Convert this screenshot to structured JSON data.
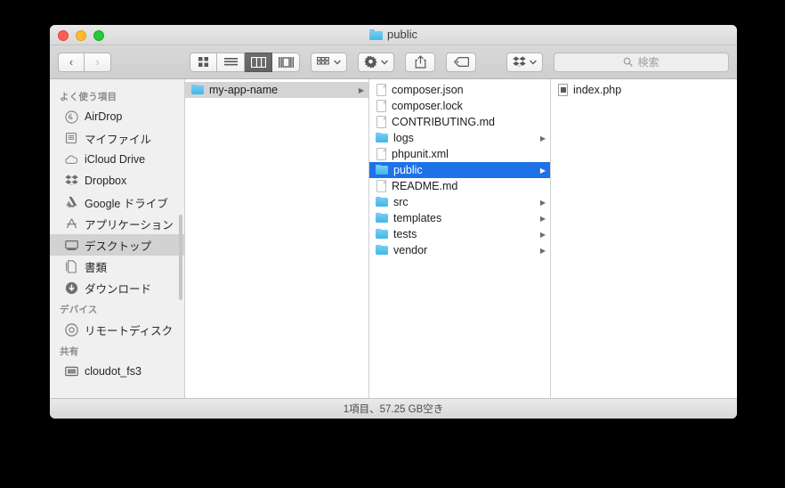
{
  "window": {
    "title": "public",
    "title_icon": "folder-icon",
    "traffic_lights": [
      "close-button",
      "minimize-button",
      "zoom-button"
    ]
  },
  "toolbar": {
    "back_label": "‹",
    "forward_label": "›",
    "view_modes": [
      {
        "name": "icon-view",
        "active": false
      },
      {
        "name": "list-view",
        "active": false
      },
      {
        "name": "column-view",
        "active": true
      },
      {
        "name": "gallery-view",
        "active": false
      }
    ],
    "arrange_label": "arrange-icon",
    "action_label": "gear-icon",
    "share_label": "share-icon",
    "tag_label": "tag-icon",
    "dropbox_label": "dropbox-icon"
  },
  "search": {
    "placeholder": "検索",
    "value": "",
    "icon": "search-icon"
  },
  "sidebar": {
    "sections": [
      {
        "header": "よく使う項目",
        "items": [
          {
            "label": "AirDrop",
            "icon": "airdrop-icon",
            "selected": false
          },
          {
            "label": "マイファイル",
            "icon": "myfiles-icon",
            "selected": false
          },
          {
            "label": "iCloud Drive",
            "icon": "icloud-icon",
            "selected": false
          },
          {
            "label": "Dropbox",
            "icon": "dropbox-icon",
            "selected": false
          },
          {
            "label": "Google ドライブ",
            "icon": "google-drive-icon",
            "selected": false
          },
          {
            "label": "アプリケーション",
            "icon": "applications-icon",
            "selected": false
          },
          {
            "label": "デスクトップ",
            "icon": "desktop-icon",
            "selected": true
          },
          {
            "label": "書類",
            "icon": "documents-icon",
            "selected": false
          },
          {
            "label": "ダウンロード",
            "icon": "downloads-icon",
            "selected": false
          }
        ]
      },
      {
        "header": "デバイス",
        "items": [
          {
            "label": "リモートディスク",
            "icon": "remote-disk-icon",
            "selected": false
          }
        ]
      },
      {
        "header": "共有",
        "items": [
          {
            "label": "cloudot_fs3",
            "icon": "server-icon",
            "selected": false
          }
        ]
      }
    ]
  },
  "columns": [
    {
      "name": "column-1",
      "rows": [
        {
          "label": "my-app-name",
          "kind": "folder",
          "disclosure": true,
          "selection": "inactive"
        }
      ]
    },
    {
      "name": "column-2",
      "rows": [
        {
          "label": "composer.json",
          "kind": "doc",
          "disclosure": false,
          "selection": "none"
        },
        {
          "label": "composer.lock",
          "kind": "doc",
          "disclosure": false,
          "selection": "none"
        },
        {
          "label": "CONTRIBUTING.md",
          "kind": "doc",
          "disclosure": false,
          "selection": "none"
        },
        {
          "label": "logs",
          "kind": "folder",
          "disclosure": true,
          "selection": "none"
        },
        {
          "label": "phpunit.xml",
          "kind": "doc",
          "disclosure": false,
          "selection": "none"
        },
        {
          "label": "public",
          "kind": "folder",
          "disclosure": true,
          "selection": "active"
        },
        {
          "label": "README.md",
          "kind": "doc",
          "disclosure": false,
          "selection": "none"
        },
        {
          "label": "src",
          "kind": "folder",
          "disclosure": true,
          "selection": "none"
        },
        {
          "label": "templates",
          "kind": "folder",
          "disclosure": true,
          "selection": "none"
        },
        {
          "label": "tests",
          "kind": "folder",
          "disclosure": true,
          "selection": "none"
        },
        {
          "label": "vendor",
          "kind": "folder",
          "disclosure": true,
          "selection": "none"
        }
      ]
    },
    {
      "name": "column-3",
      "rows": [
        {
          "label": "index.php",
          "kind": "php",
          "disclosure": false,
          "selection": "none"
        }
      ]
    }
  ],
  "statusbar": {
    "text": "1項目、57.25 GB空き"
  },
  "colors": {
    "selection_blue": "#1e72e8",
    "folder_blue": "#45b9ea",
    "window_chrome": "#d8d8d8"
  }
}
